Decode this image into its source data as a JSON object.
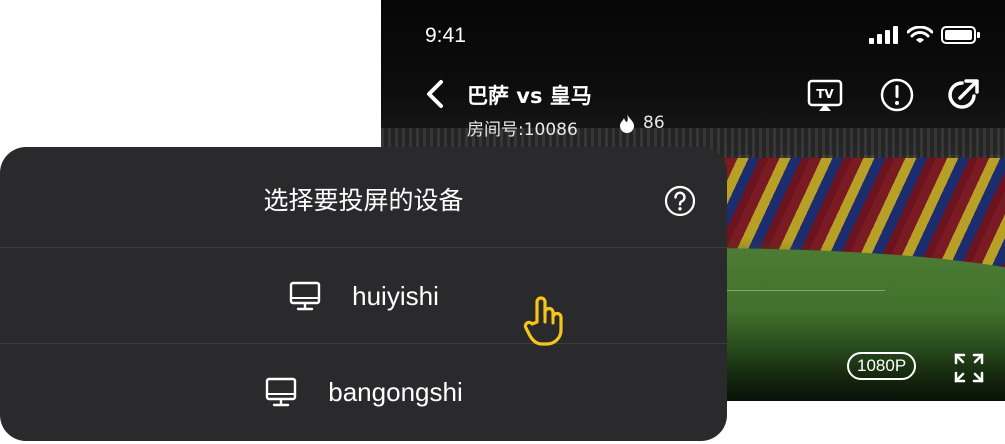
{
  "status_bar": {
    "time": "9:41"
  },
  "player": {
    "match_title": "巴萨 vs 皇马",
    "room_number": "房间号:10086",
    "heat_count": "86",
    "quality": "1080P",
    "icons": [
      "back-chevron-icon",
      "tv-cast-icon",
      "report-icon",
      "share-icon",
      "flame-icon",
      "fullscreen-icon"
    ]
  },
  "cast_dialog": {
    "title": "选择要投屏的设备",
    "devices": [
      {
        "name": "huiyishi",
        "icon": "monitor-icon"
      },
      {
        "name": "bangongshi",
        "icon": "monitor-icon"
      }
    ],
    "help_icon": "help-circle-icon"
  },
  "colors": {
    "dialog_bg": "#2a2a2c",
    "divider": "#3e3e40",
    "touch_hint": "#f5c518"
  }
}
